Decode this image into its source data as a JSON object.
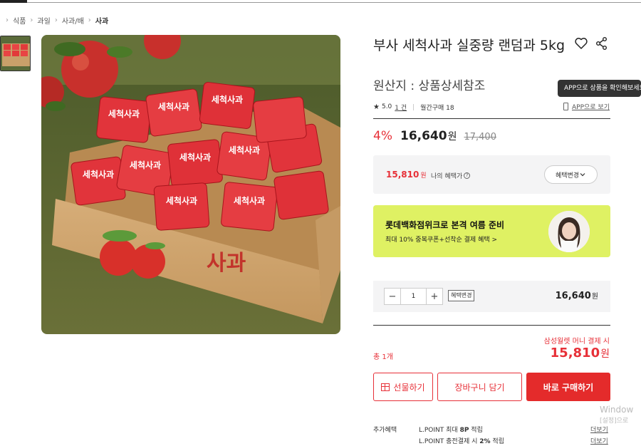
{
  "breadcrumb": {
    "items": [
      "식품",
      "과일",
      "사과/배",
      "사과"
    ]
  },
  "product": {
    "title": "부사 세척사과 실중량 랜덤과 5kg",
    "origin": "원산지 : 상품상세참조",
    "rating": "5.0",
    "review_count": "1 건",
    "monthly_sales": "월간구매 18",
    "app_link": "APP으로 보기",
    "discount_rate": "4%",
    "price": "16,640",
    "original_price": "17,400",
    "currency": "원",
    "image_box_text": "사과",
    "image_bag_text": "세척사과"
  },
  "tooltip": {
    "text": "APP으로 상품을 확인해보세요"
  },
  "benefit": {
    "price": "15,810",
    "currency": "원",
    "label": "나의 혜택가",
    "change_button": "혜택변경"
  },
  "promo": {
    "title": "롯데백화점위크로 본격 여름 준비",
    "subtitle": "최대 10% 중복쿠폰+선착순 결제 혜택 >"
  },
  "quantity": {
    "value": "1",
    "minus": "−",
    "plus": "+",
    "change_tag": "혜택변경",
    "line_price": "16,640",
    "currency": "원"
  },
  "summary": {
    "samsung_text": "삼성월렛 머니 결제 시",
    "total_label": "총 1개",
    "total_price": "15,810",
    "currency": "원"
  },
  "buttons": {
    "gift": "선물하기",
    "cart": "장바구니 담기",
    "buy": "바로 구매하기"
  },
  "extra": {
    "label": "추가혜택",
    "line1_prefix": "L.POINT 최대 ",
    "line1_bold": "8P",
    "line1_suffix": " 적립",
    "line2_prefix": "L.POINT 충전결제 시 ",
    "line2_bold": "2%",
    "line2_suffix": " 적립",
    "more": "더보기"
  },
  "watermark": {
    "line1": "Window",
    "line2": "[설정]으로"
  },
  "colors": {
    "accent_red": "#e73038",
    "promo_green": "#dff163",
    "panel_gray": "#f4f4f5"
  }
}
